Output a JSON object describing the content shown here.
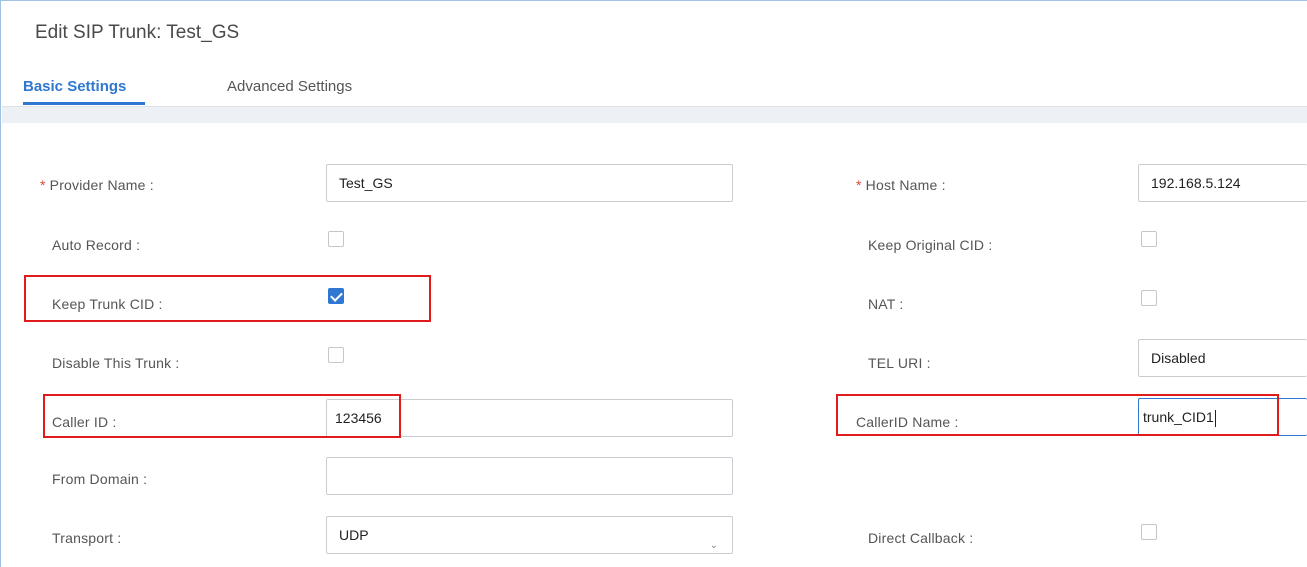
{
  "page": {
    "title": "Edit SIP Trunk: Test_GS"
  },
  "tabs": [
    {
      "label": "Basic Settings",
      "active": true
    },
    {
      "label": "Advanced Settings",
      "active": false
    }
  ],
  "left_fields": {
    "provider_name": {
      "label": "Provider Name :",
      "required": true,
      "value": "Test_GS"
    },
    "auto_record": {
      "label": "Auto Record :",
      "checked": false
    },
    "keep_trunk_cid": {
      "label": "Keep Trunk CID :",
      "checked": true
    },
    "disable_trunk": {
      "label": "Disable This Trunk :",
      "checked": false
    },
    "caller_id": {
      "label": "Caller ID :",
      "value": "123456"
    },
    "from_domain": {
      "label": "From Domain :",
      "value": ""
    },
    "transport": {
      "label": "Transport :",
      "value": "UDP"
    }
  },
  "right_fields": {
    "host_name": {
      "label": "Host Name :",
      "required": true,
      "value": "192.168.5.124"
    },
    "keep_original_cid": {
      "label": "Keep Original CID :",
      "checked": false
    },
    "nat": {
      "label": "NAT :",
      "checked": false
    },
    "tel_uri": {
      "label": "TEL URI :",
      "value": "Disabled"
    },
    "callerid_name": {
      "label": "CallerID Name :",
      "value": "trunk_CID1"
    },
    "direct_callback": {
      "label": "Direct Callback :",
      "checked": false
    }
  },
  "colors": {
    "accent": "#2f77d1",
    "required": "#e0443a",
    "highlight": "#e01b1b"
  },
  "icons": {
    "required_marker": "*",
    "select_arrow": "chevron-down-icon"
  }
}
